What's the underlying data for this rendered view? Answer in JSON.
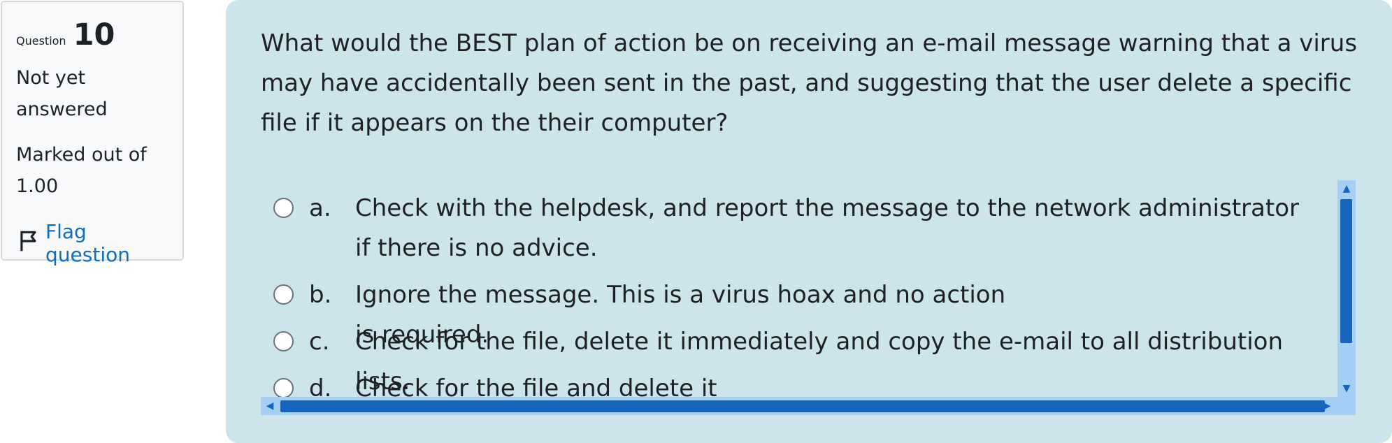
{
  "info": {
    "question_label": "Question",
    "question_number": "10",
    "state_line1": "Not yet",
    "state_line2": "answered",
    "grade_line1": "Marked out of",
    "grade_line2": "1.00",
    "flag_label": "Flag question",
    "flag_icon": "flag-outline-icon"
  },
  "question": {
    "text": "What would the BEST plan of action be on receiving an e-mail message warning that a virus may have accidentally been sent in the past, and suggesting that the user delete a specific file if it appears on the their computer?"
  },
  "answers": [
    {
      "letter": "a.",
      "text": "Check with the helpdesk, and report the message to the network administrator if there is no advice."
    },
    {
      "letter": "b.",
      "text": "Ignore the message. This is a virus hoax and no action is required."
    },
    {
      "letter": "c.",
      "text": "Check for the file, delete it immediately and copy the e-mail to all distribution lists."
    },
    {
      "letter": "d.",
      "text": "Check for the file and delete it"
    }
  ],
  "scroll": {
    "up": "▲",
    "down": "▼",
    "left": "◀",
    "right": "▶"
  },
  "colors": {
    "panel_bg": "#cce5ea",
    "info_bg": "#f8f9fa",
    "link": "#0f6cbf",
    "scrollbar_track": "#a6cff5",
    "scrollbar_thumb": "#1565c0"
  }
}
